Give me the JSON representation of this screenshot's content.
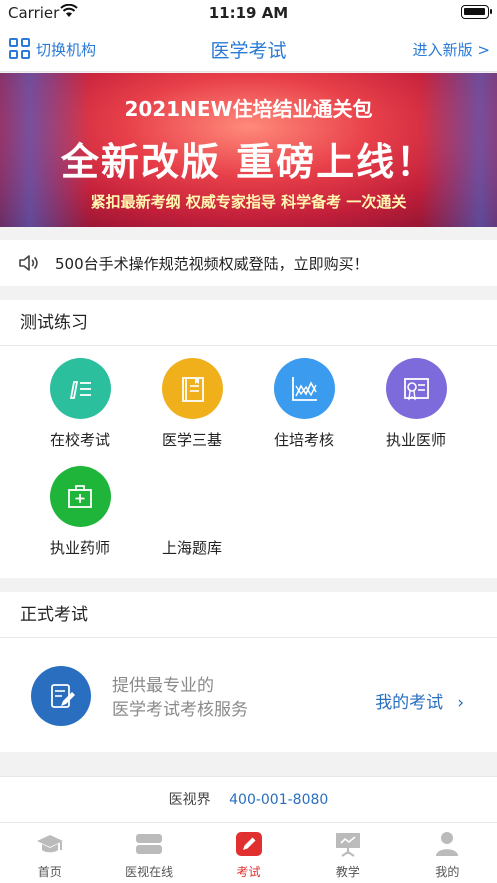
{
  "status_bar": {
    "carrier": "Carrier",
    "time": "11:19 AM"
  },
  "nav": {
    "left_label": "切换机构",
    "title": "医学考试",
    "right_label": "进入新版 >"
  },
  "banner": {
    "subtitle": "2021NEW住培结业通关包",
    "headline": "全新改版 重磅上线！",
    "tagline": "紧扣最新考纲  权威专家指导  科学备考  一次通关"
  },
  "notice": {
    "text": "500台手术操作规范视频权威登陆，立即购买！"
  },
  "practice": {
    "title": "测试练习",
    "items": [
      {
        "label": "在校考试",
        "color": "#2bbf9e",
        "icon": "writing-icon"
      },
      {
        "label": "医学三基",
        "color": "#f0b01b",
        "icon": "book-icon"
      },
      {
        "label": "住培考核",
        "color": "#3a9bef",
        "icon": "chart-icon"
      },
      {
        "label": "执业医师",
        "color": "#7d6bdc",
        "icon": "certificate-icon"
      },
      {
        "label": "执业药师",
        "color": "#1fb43a",
        "icon": "medkit-icon"
      },
      {
        "label": "上海题库",
        "color": "",
        "icon": ""
      }
    ]
  },
  "exam": {
    "title": "正式考试",
    "desc_line1": "提供最专业的",
    "desc_line2": "医学考试考核服务",
    "link": "我的考试"
  },
  "contact": {
    "brand": "医视界",
    "phone": "400-001-8080"
  },
  "tabs": [
    {
      "label": "首页",
      "icon": "graduation-cap-icon",
      "active": false
    },
    {
      "label": "医视在线",
      "icon": "video-icon",
      "active": false
    },
    {
      "label": "考试",
      "icon": "exam-edit-icon",
      "active": true
    },
    {
      "label": "教学",
      "icon": "presentation-icon",
      "active": false
    },
    {
      "label": "我的",
      "icon": "user-icon",
      "active": false
    }
  ],
  "colors": {
    "accent": "#2a7ad6",
    "active_tab": "#e03030"
  }
}
